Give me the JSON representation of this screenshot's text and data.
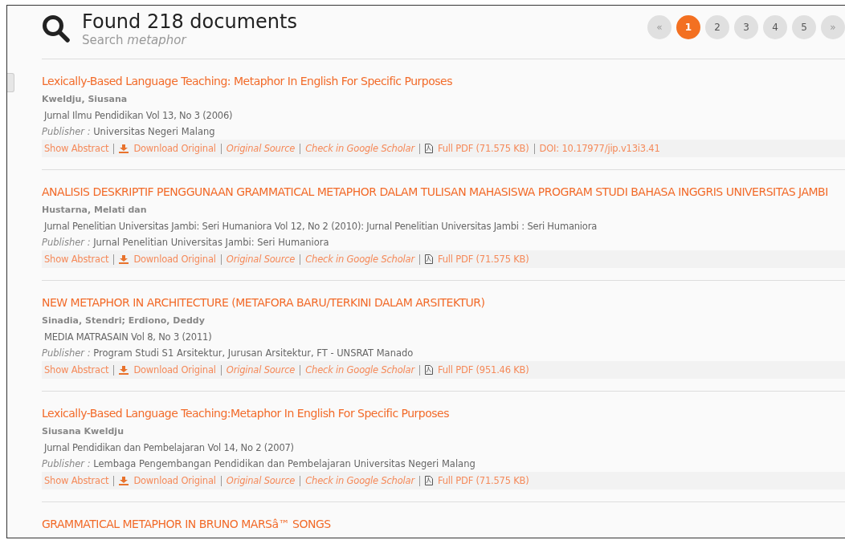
{
  "header": {
    "title": "Found 218 documents",
    "search_label": "Search",
    "query": "metaphor"
  },
  "pagination": [
    {
      "label": "«",
      "selected": false
    },
    {
      "label": "1",
      "selected": true
    },
    {
      "label": "2",
      "selected": false
    },
    {
      "label": "3",
      "selected": false
    },
    {
      "label": "4",
      "selected": false
    },
    {
      "label": "5",
      "selected": false
    },
    {
      "label": "»",
      "selected": false
    }
  ],
  "results": [
    {
      "title": "Lexically-Based Language Teaching: Metaphor In English For Specific Purposes",
      "authors": "Kweldju, Siusana",
      "journal": "Jurnal Ilmu Pendidikan  Vol 13, No 3 (2006)",
      "publisher_label": "Publisher :",
      "publisher": "Universitas Negeri Malang",
      "links": [
        {
          "kind": "plain",
          "label": "Show Abstract"
        },
        {
          "kind": "download",
          "label": "Download Original"
        },
        {
          "kind": "italic",
          "label": "Original Source"
        },
        {
          "kind": "italic",
          "label": "Check in Google Scholar"
        },
        {
          "kind": "pdf",
          "label": "Full PDF (71.575 KB)"
        },
        {
          "kind": "plain",
          "label": "DOI: 10.17977/jip.v13i3.41"
        }
      ]
    },
    {
      "title": "ANALISIS DESKRIPTIF PENGGUNAAN GRAMMATICAL METAPHOR DALAM TULISAN MAHASISWA PROGRAM STUDI BAHASA INGGRIS UNIVERSITAS JAMBI",
      "authors": "Hustarna, Melati dan",
      "journal": "Jurnal Penelitian Universitas Jambi: Seri Humaniora  Vol 12, No 2 (2010): Jurnal Penelitian Universitas Jambi : Seri Humaniora",
      "publisher_label": "Publisher :",
      "publisher": "Jurnal Penelitian Universitas Jambi: Seri Humaniora",
      "links": [
        {
          "kind": "plain",
          "label": "Show Abstract"
        },
        {
          "kind": "download",
          "label": "Download Original"
        },
        {
          "kind": "italic",
          "label": "Original Source"
        },
        {
          "kind": "italic",
          "label": "Check in Google Scholar"
        },
        {
          "kind": "pdf",
          "label": "Full PDF (71.575 KB)"
        }
      ]
    },
    {
      "title": "NEW METAPHOR IN ARCHITECTURE (METAFORA BARU/TERKINI DALAM ARSITEKTUR)",
      "authors": "Sinadia, Stendri; Erdiono, Deddy",
      "journal": "MEDIA MATRASAIN  Vol 8, No 3 (2011)",
      "publisher_label": "Publisher :",
      "publisher": "Program Studi S1 Arsitektur, Jurusan Arsitektur, FT - UNSRAT Manado",
      "links": [
        {
          "kind": "plain",
          "label": "Show Abstract"
        },
        {
          "kind": "download",
          "label": "Download Original"
        },
        {
          "kind": "italic",
          "label": "Original Source"
        },
        {
          "kind": "italic",
          "label": "Check in Google Scholar"
        },
        {
          "kind": "pdf",
          "label": "Full PDF (951.46 KB)"
        }
      ]
    },
    {
      "title": "Lexically-Based Language Teaching:Metaphor In English For Specific Purposes",
      "authors": "Siusana Kweldju",
      "journal": "Jurnal Pendidikan dan Pembelajaran  Vol 14, No 2 (2007)",
      "publisher_label": "Publisher :",
      "publisher": "Lembaga Pengembangan Pendidikan dan Pembelajaran Universitas Negeri Malang",
      "links": [
        {
          "kind": "plain",
          "label": "Show Abstract"
        },
        {
          "kind": "download",
          "label": "Download Original"
        },
        {
          "kind": "italic",
          "label": "Original Source"
        },
        {
          "kind": "italic",
          "label": "Check in Google Scholar"
        },
        {
          "kind": "pdf",
          "label": "Full PDF (71.575 KB)"
        }
      ]
    },
    {
      "title": "GRAMMATICAL METAPHOR IN BRUNO MARSâ™ SONGS"
    }
  ]
}
